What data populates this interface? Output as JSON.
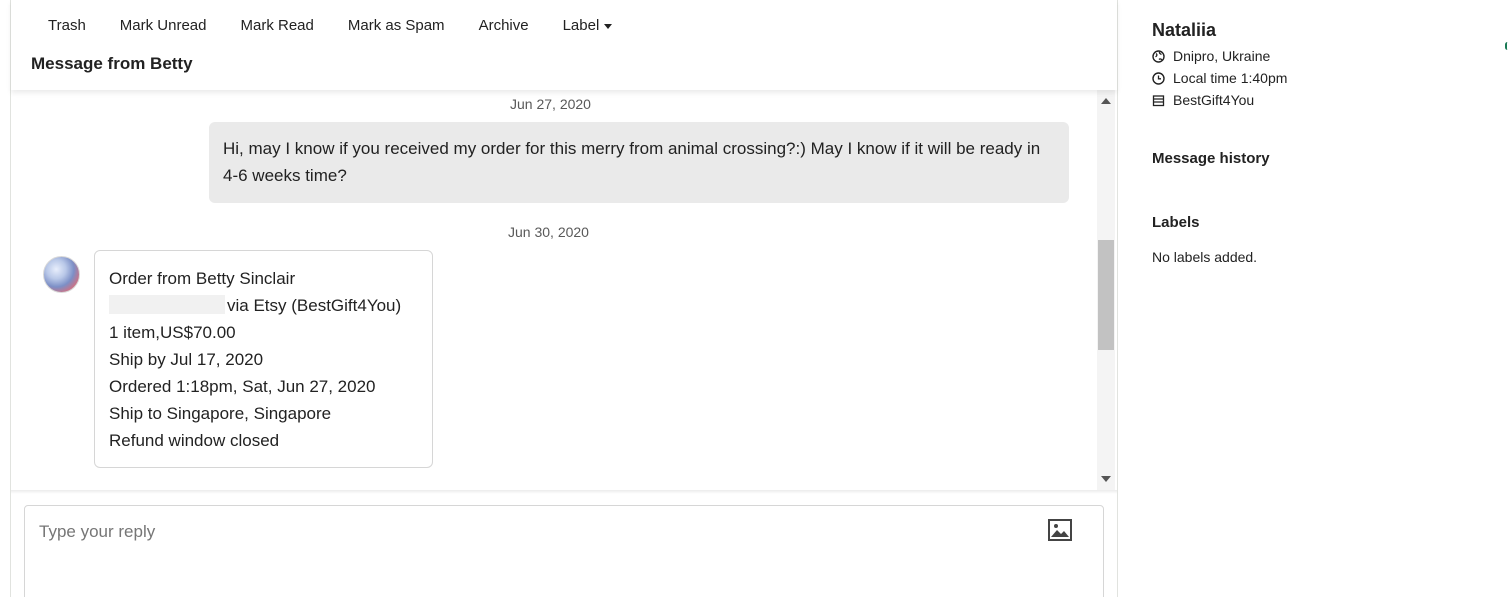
{
  "toolbar": {
    "trash": "Trash",
    "mark_unread": "Mark Unread",
    "mark_read": "Mark Read",
    "mark_spam": "Mark as Spam",
    "archive": "Archive",
    "label": "Label"
  },
  "page_title": "Message from Betty",
  "conversation": {
    "date_1": "Jun 27, 2020",
    "outgoing_message": "Hi, may I know if you received my order for this merry from animal crossing?:) May I know if it will be ready in 4-6 weeks time?",
    "date_2": "Jun 30, 2020",
    "order_card": {
      "title": "Order from Betty Sinclair",
      "via": "via Etsy (BestGift4You)",
      "items": "1 item,US$70.00",
      "ship_by": "Ship by Jul 17, 2020",
      "ordered": "Ordered 1:18pm, Sat, Jun 27, 2020",
      "ship_to": "Ship to Singapore, Singapore",
      "refund": "Refund window closed"
    }
  },
  "reply": {
    "placeholder": "Type your reply"
  },
  "sidebar": {
    "name": "Nataliia",
    "location": "Dnipro, Ukraine",
    "local_time": "Local time 1:40pm",
    "shop": "BestGift4You",
    "message_history": "Message history",
    "labels_title": "Labels",
    "no_labels": "No labels added."
  },
  "icons": {
    "location": "globe-icon",
    "time": "clock-icon",
    "shop": "shop-icon",
    "image": "image-icon"
  }
}
